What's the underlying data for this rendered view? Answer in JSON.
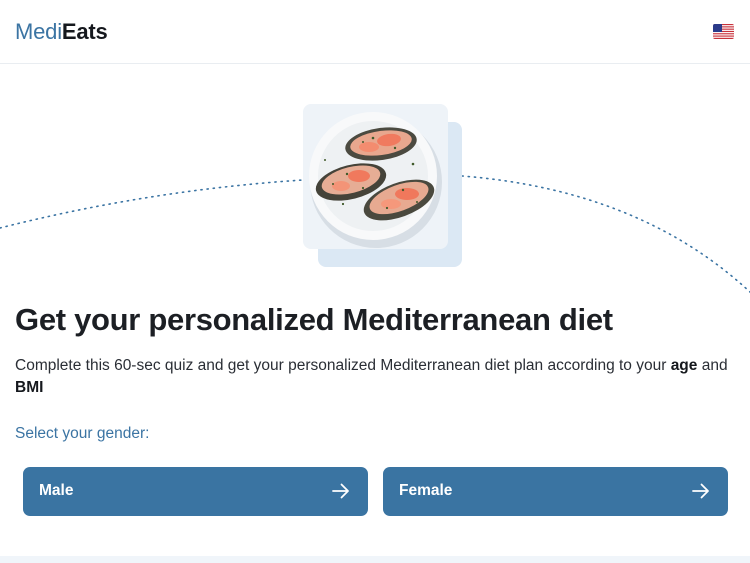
{
  "header": {
    "logo_part1": "Medi",
    "logo_part2": "Eats",
    "language_flag": "us-flag-icon"
  },
  "hero": {
    "image": "salmon-toast-plate-image"
  },
  "main": {
    "headline": "Get your personalized Mediterranean diet",
    "description_prefix": "Complete this 60-sec quiz and get your personalized Mediterranean diet plan according to your ",
    "description_age": "age",
    "description_and": " and ",
    "description_bmi": "BMI",
    "gender_prompt": "Select your gender:",
    "options": [
      {
        "label": "Male",
        "icon": "arrow-right-icon"
      },
      {
        "label": "Female",
        "icon": "arrow-right-icon"
      }
    ]
  },
  "colors": {
    "brand_blue": "#3a74a2",
    "text_dark": "#1c1f24"
  }
}
